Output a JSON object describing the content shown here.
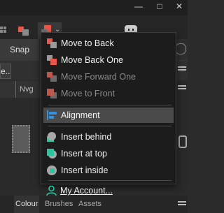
{
  "app": {
    "tab_label": "Snap",
    "context_field_text": "e...",
    "panel_tab_label": "Nvg",
    "bottom_tabs": [
      "Colour",
      "Brushes",
      "Assets"
    ]
  },
  "menu": {
    "items": [
      {
        "label": "Move to Back",
        "icon": "move-to-back-icon",
        "enabled": true
      },
      {
        "label": "Move Back One",
        "icon": "move-back-one-icon",
        "enabled": true
      },
      {
        "label": "Move Forward One",
        "icon": "move-forward-one-icon",
        "enabled": false
      },
      {
        "label": "Move to Front",
        "icon": "move-to-front-icon",
        "enabled": false
      },
      {
        "label": "Alignment",
        "icon": "alignment-icon",
        "enabled": true,
        "highlighted": true
      },
      {
        "label": "Insert behind",
        "icon": "insert-behind-icon",
        "enabled": true
      },
      {
        "label": "Insert at top",
        "icon": "insert-at-top-icon",
        "enabled": true
      },
      {
        "label": "Insert inside",
        "icon": "insert-inside-icon",
        "enabled": true
      },
      {
        "label": "My Account...",
        "icon": "account-icon",
        "enabled": true
      }
    ]
  },
  "colors": {
    "menu_bg": "#1c1c1c",
    "highlight_bg": "#4a4a4a",
    "accent_teal": "#2dc5a0",
    "accent_red": "#e8584a",
    "disabled_text": "#8a8a8a"
  }
}
